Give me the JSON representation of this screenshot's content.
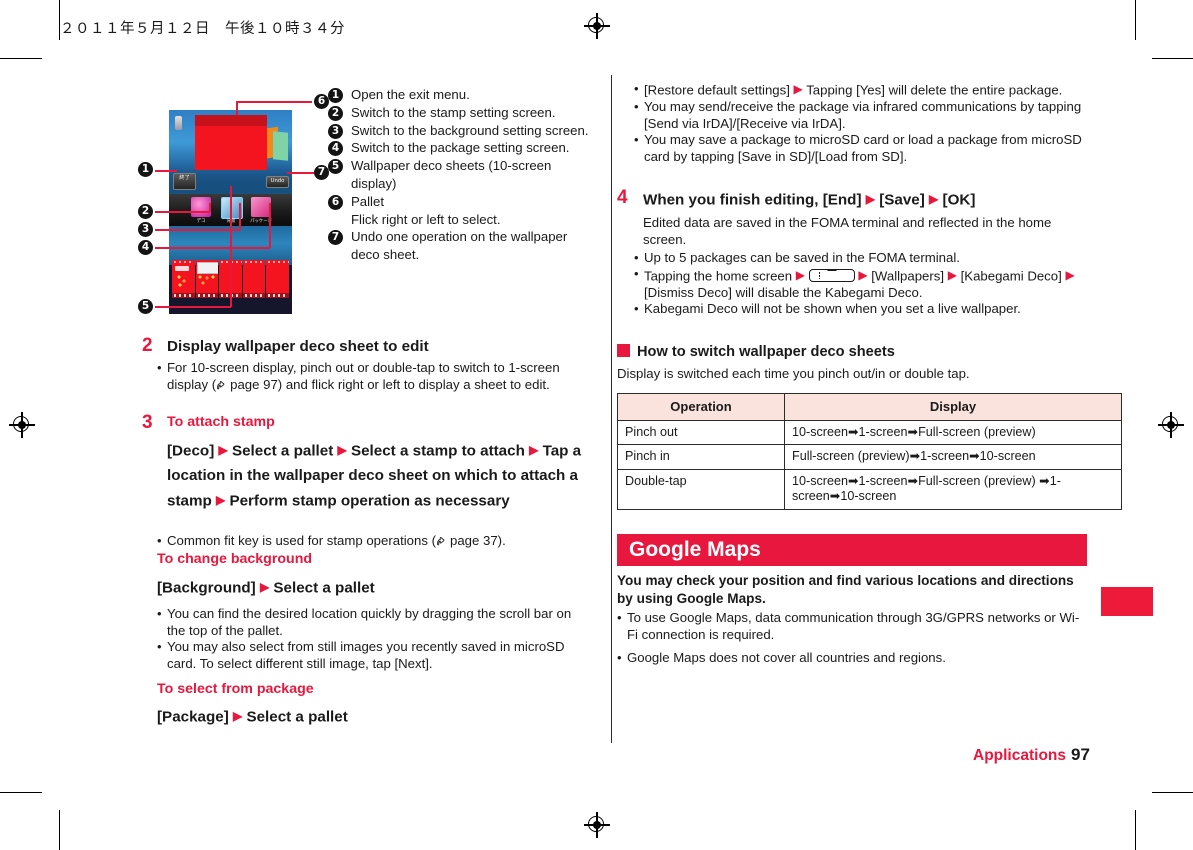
{
  "header": {
    "datetime": "２０１１年５月１２日　午後１０時３４分"
  },
  "footer": {
    "section": "Applications",
    "page_number": "97"
  },
  "figure": {
    "phone_ui": {
      "exit_button": "終了",
      "undo_button": "Undo",
      "pallet_labels": [
        "デコ",
        "背景",
        "パッケージ"
      ]
    },
    "callouts": [
      "1",
      "2",
      "3",
      "4",
      "5",
      "6",
      "7"
    ]
  },
  "legend": {
    "items": [
      {
        "num": "1",
        "text": "Open the exit menu."
      },
      {
        "num": "2",
        "text": "Switch to the stamp setting screen."
      },
      {
        "num": "3",
        "text": "Switch to the background setting screen."
      },
      {
        "num": "4",
        "text": "Switch to the package setting screen."
      },
      {
        "num": "5",
        "text": "Wallpaper deco sheets (10-screen display)"
      },
      {
        "num": "6",
        "text": "Pallet\nFlick right or left to select."
      },
      {
        "num": "7",
        "text": "Undo one operation on the wallpaper deco sheet."
      }
    ]
  },
  "left_column": {
    "step2": {
      "number": "2",
      "heading": "Display wallpaper deco sheet to edit",
      "bullets": [
        "For 10-screen display, pinch out or double-tap to switch to 1-screen display ( page 97) and flick right or left to display a sheet to edit."
      ],
      "ref_page": "page 97"
    },
    "step3": {
      "number": "3",
      "heading": "To attach stamp",
      "procedure": "[Deco] ► Select a pallet ► Select a stamp to attach ► Tap a location in the wallpaper deco sheet on which to attach a stamp ► Perform stamp operation as necessary",
      "procedure_parts": [
        "[Deco]",
        "Select a pallet",
        "Select a stamp to attach",
        "Tap a location in the wallpaper deco sheet on which to attach a stamp",
        "Perform stamp operation as necessary"
      ],
      "bullets_after": [
        "Common fit key is used for stamp operations ( page 37)."
      ],
      "ref_page": "page 37",
      "subhead_background": "To change background",
      "procedure_background_parts": [
        "[Background]",
        "Select a pallet"
      ],
      "bullets_background": [
        "You can find the desired location quickly by dragging the scroll bar on the top of the pallet.",
        "You may also select from still images you recently saved in microSD card. To select different still image, tap [Next]."
      ],
      "subhead_package": "To select from package",
      "procedure_package_parts": [
        "[Package]",
        "Select a pallet"
      ]
    }
  },
  "right_column": {
    "top_bullets": [
      "[Restore default settings] ► Tapping [Yes] will delete the entire package.",
      "You may send/receive the package via infrared communications by tapping [Send via IrDA]/[Receive via IrDA].",
      "You may save a package to microSD card or load a package from microSD card by tapping [Save in SD]/[Load from SD]."
    ],
    "step4": {
      "number": "4",
      "heading_parts": [
        "When you finish editing, [End]",
        "[Save]",
        "[OK]"
      ],
      "body": "Edited data are saved in the FOMA terminal and reflected in the home screen.",
      "bullets": [
        "Up to 5 packages can be saved in the FOMA terminal.",
        "Tapping the home screen ► [menu-key] ► [Wallpapers] ► [Kabegami Deco] ► [Dismiss Deco] will disable the Kabegami Deco.",
        "Kabegami Deco will not be shown when you set a live wallpaper."
      ]
    },
    "how_to_switch": {
      "heading": "How to switch wallpaper deco sheets",
      "intro": "Display is switched each time you pinch out/in or double tap.",
      "table": {
        "columns": [
          "Operation",
          "Display"
        ],
        "rows": [
          [
            "Pinch out",
            "10-screen➡1-screen➡Full-screen (preview)"
          ],
          [
            "Pinch in",
            "Full-screen (preview)➡1-screen➡10-screen"
          ],
          [
            "Double-tap",
            "10-screen➡1-screen➡Full-screen (preview) ➡1-screen➡10-screen"
          ]
        ]
      }
    },
    "google_maps": {
      "banner": "Google Maps",
      "lead": "You may check your position and find various locations and directions by using Google Maps.",
      "bullets": [
        "To use Google Maps, data communication through 3G/GPRS networks or Wi-Fi connection is required.",
        "Google Maps does not cover all countries and regions."
      ]
    }
  },
  "colors": {
    "accent_red": "#e8173d",
    "table_header_bg": "#fae3dd",
    "text": "#1a1a1a"
  }
}
